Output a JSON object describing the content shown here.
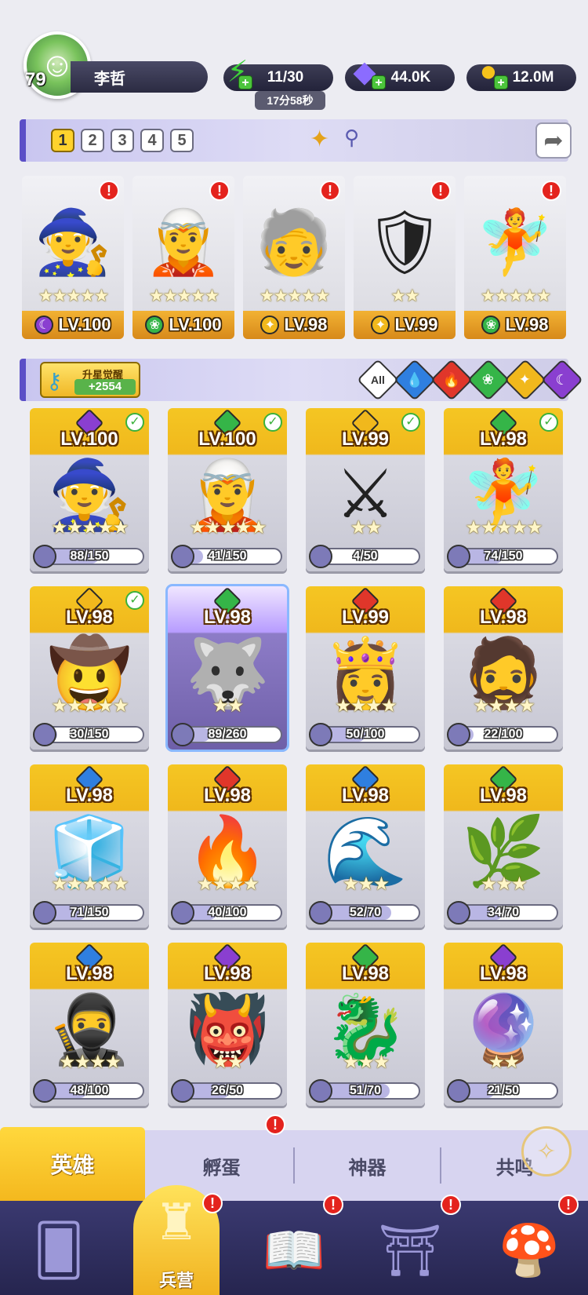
{
  "player": {
    "level": "79",
    "name": "李哲",
    "avatar_icon": "avatar-icon"
  },
  "resources": {
    "energy": {
      "value": "11/30",
      "timer": "17分58秒",
      "icon": "lightning-icon",
      "color": "#3fd23a"
    },
    "gems": {
      "value": "44.0K",
      "icon": "gem-icon",
      "color": "#8b6cff"
    },
    "gold": {
      "value": "12.0M",
      "icon": "coin-icon",
      "color": "#f5c21b"
    }
  },
  "team_tabs": [
    "1",
    "2",
    "3",
    "4",
    "5"
  ],
  "team_active_tab": "1",
  "team_heroes": [
    {
      "level": "LV.100",
      "element": "dark",
      "stars": 5
    },
    {
      "level": "LV.100",
      "element": "nature",
      "stars": 5
    },
    {
      "level": "LV.98",
      "element": "light",
      "stars": 5
    },
    {
      "level": "LV.99",
      "element": "light",
      "stars": 2
    },
    {
      "level": "LV.98",
      "element": "nature",
      "stars": 5
    }
  ],
  "filter": {
    "awaken_label": "升星觉醒",
    "awaken_count": "+2554",
    "all_label": "All",
    "elements": [
      {
        "name": "water",
        "color": "#2f7fe0"
      },
      {
        "name": "fire",
        "color": "#e0362a"
      },
      {
        "name": "nature",
        "color": "#35b548"
      },
      {
        "name": "light",
        "color": "#f1b81c"
      },
      {
        "name": "dark",
        "color": "#8a3fd0"
      }
    ]
  },
  "heroes": [
    {
      "level": "LV.100",
      "element": "dark",
      "stars": 5,
      "shards": "88/150",
      "progress": 0.59,
      "checked": true
    },
    {
      "level": "LV.100",
      "element": "nature",
      "stars": 5,
      "shards": "41/150",
      "progress": 0.27,
      "checked": true
    },
    {
      "level": "LV.99",
      "element": "light",
      "stars": 2,
      "shards": "4/50",
      "progress": 0.08,
      "checked": true
    },
    {
      "level": "LV.98",
      "element": "nature",
      "stars": 5,
      "shards": "74/150",
      "progress": 0.49,
      "checked": true
    },
    {
      "level": "LV.98",
      "element": "light",
      "stars": 5,
      "shards": "30/150",
      "progress": 0.2,
      "checked": true
    },
    {
      "level": "LV.98",
      "element": "nature",
      "stars": 2,
      "shards": "89/260",
      "progress": 0.34,
      "checked": false,
      "special": true
    },
    {
      "level": "LV.99",
      "element": "fire",
      "stars": 4,
      "shards": "50/100",
      "progress": 0.5,
      "checked": false
    },
    {
      "level": "LV.98",
      "element": "fire",
      "stars": 4,
      "shards": "22/100",
      "progress": 0.22,
      "checked": false
    },
    {
      "level": "LV.98",
      "element": "water",
      "stars": 5,
      "shards": "71/150",
      "progress": 0.47,
      "checked": false
    },
    {
      "level": "LV.98",
      "element": "fire",
      "stars": 4,
      "shards": "40/100",
      "progress": 0.4,
      "checked": false
    },
    {
      "level": "LV.98",
      "element": "water",
      "stars": 3,
      "shards": "52/70",
      "progress": 0.74,
      "checked": false
    },
    {
      "level": "LV.98",
      "element": "nature",
      "stars": 3,
      "shards": "34/70",
      "progress": 0.49,
      "checked": false
    },
    {
      "level": "LV.98",
      "element": "water",
      "stars": 4,
      "shards": "48/100",
      "progress": 0.48,
      "checked": false
    },
    {
      "level": "LV.98",
      "element": "dark",
      "stars": 2,
      "shards": "26/50",
      "progress": 0.52,
      "checked": false
    },
    {
      "level": "LV.98",
      "element": "nature",
      "stars": 3,
      "shards": "51/70",
      "progress": 0.73,
      "checked": false
    },
    {
      "level": "LV.98",
      "element": "dark",
      "stars": 2,
      "shards": "21/50",
      "progress": 0.42,
      "checked": false
    }
  ],
  "subtabs": {
    "heroes": "英雄",
    "hatch": "孵蛋",
    "artifact": "神器",
    "resonance": "共鸣"
  },
  "bottomnav": {
    "active_label": "兵营"
  }
}
